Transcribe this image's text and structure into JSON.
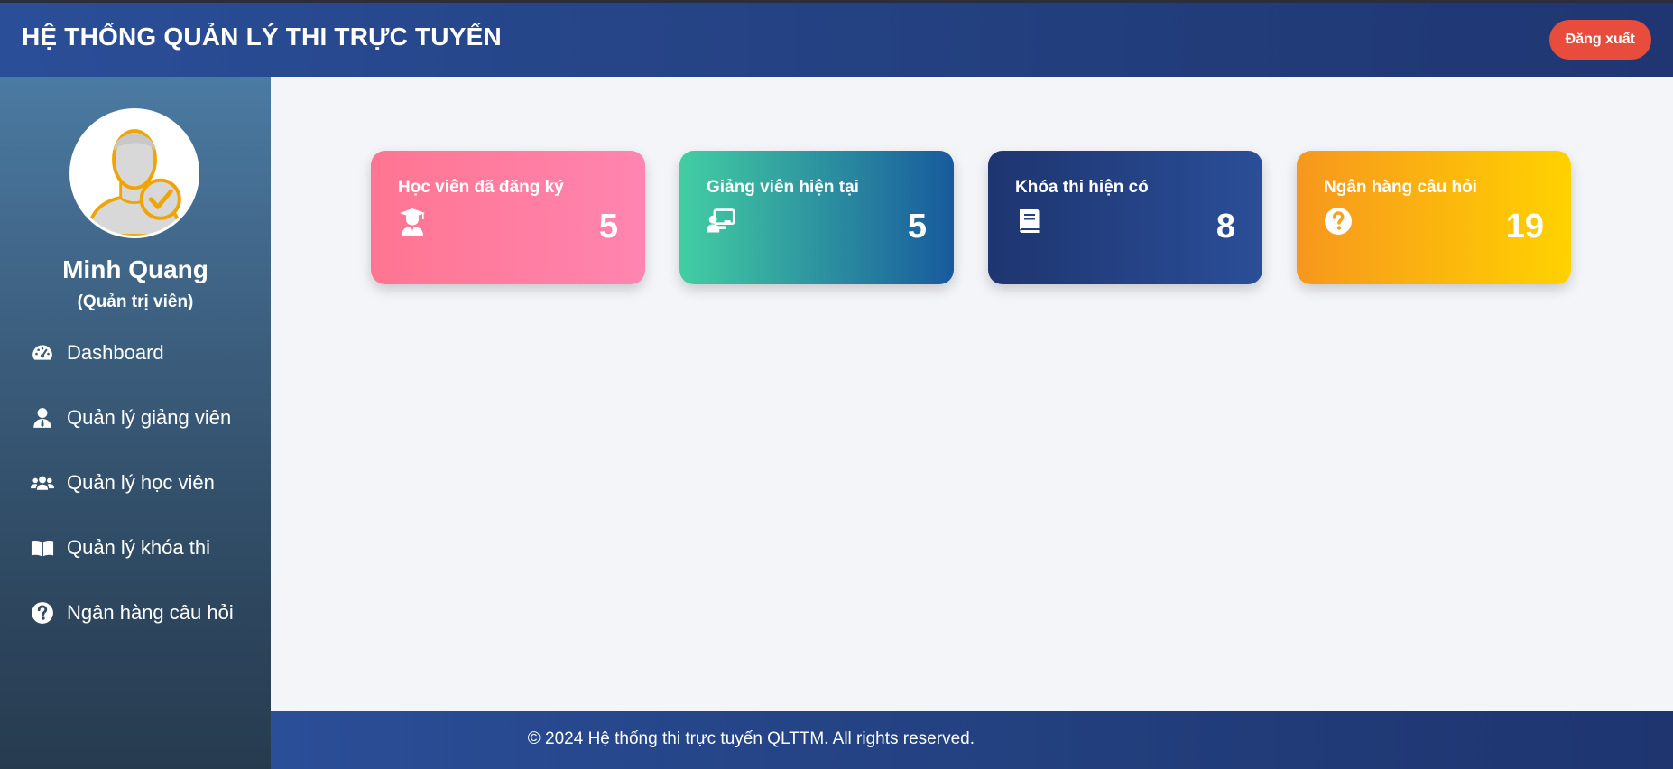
{
  "header": {
    "title": "HỆ THỐNG QUẢN LÝ THI TRỰC TUYẾN",
    "logout_label": "Đăng xuất"
  },
  "user": {
    "name": "Minh Quang",
    "role": "(Quản trị viên)"
  },
  "sidebar": {
    "items": [
      {
        "label": "Dashboard",
        "icon": "dashboard-gauge-icon"
      },
      {
        "label": "Quản lý giảng viên",
        "icon": "user-tie-icon"
      },
      {
        "label": "Quản lý học viên",
        "icon": "users-icon"
      },
      {
        "label": "Quản lý khóa thi",
        "icon": "book-open-icon"
      },
      {
        "label": "Ngân hàng câu hỏi",
        "icon": "question-circle-icon"
      }
    ]
  },
  "stats": [
    {
      "label": "Học viên đã đăng ký",
      "value": "5",
      "icon": "graduate-icon",
      "colors": [
        "#ff7591",
        "#ff85b0"
      ]
    },
    {
      "label": "Giảng viên hiện tại",
      "value": "5",
      "icon": "teacher-board-icon",
      "colors": [
        "#43cea2",
        "#185a9d"
      ]
    },
    {
      "label": "Khóa thi hiện có",
      "value": "8",
      "icon": "book-icon",
      "colors": [
        "#1e3570",
        "#2a4e98"
      ]
    },
    {
      "label": "Ngân hàng câu hỏi",
      "value": "19",
      "icon": "question-circle-icon",
      "colors": [
        "#f7971e",
        "#ffd200"
      ]
    }
  ],
  "footer": {
    "text": "© 2024 Hệ thống thi trực tuyến QLTTM. All rights reserved."
  },
  "colors": {
    "header": "#2a4e98",
    "logout": "#e74c3c",
    "content_bg": "#f4f5f9"
  }
}
